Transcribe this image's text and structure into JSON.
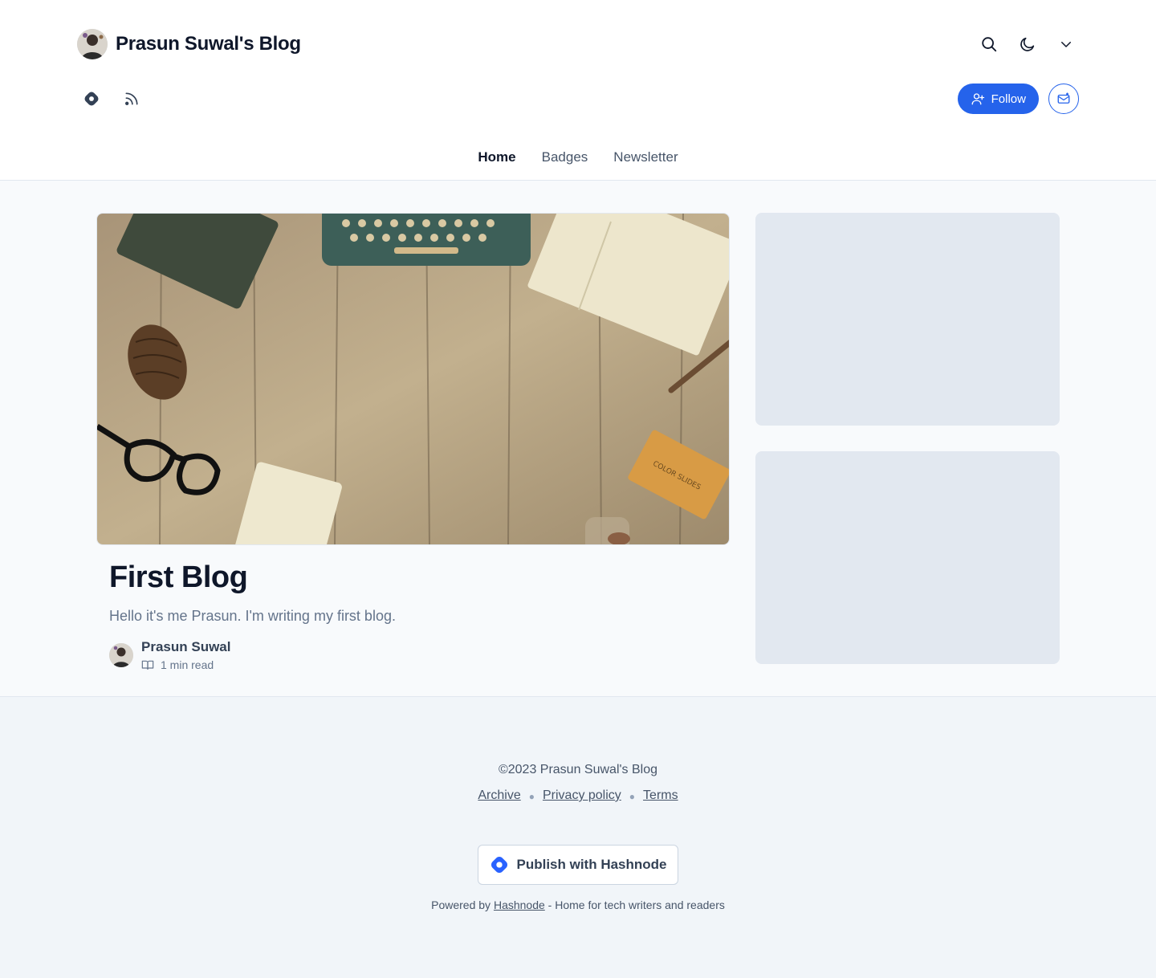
{
  "header": {
    "blog_title": "Prasun Suwal's Blog",
    "icons": [
      "search-icon",
      "moon-icon",
      "chevron-down-icon"
    ],
    "social_icons": [
      "hashnode-icon",
      "rss-icon"
    ],
    "follow_label": "Follow",
    "newsletter_icon": "mail-icon"
  },
  "nav": {
    "items": [
      {
        "label": "Home",
        "active": true
      },
      {
        "label": "Badges",
        "active": false
      },
      {
        "label": "Newsletter",
        "active": false
      }
    ]
  },
  "post": {
    "title": "First Blog",
    "brief": "Hello it's me Prasun. I'm writing my first blog.",
    "author": "Prasun Suwal",
    "read_time": "1 min read"
  },
  "footer": {
    "copyright": "©2023 Prasun Suwal's Blog",
    "links": [
      "Archive",
      "Privacy policy",
      "Terms"
    ],
    "publish_label": "Publish with Hashnode",
    "powered_prefix": "Powered by",
    "powered_link": "Hashnode",
    "powered_suffix": "- Home for tech writers and readers"
  },
  "colors": {
    "accent": "#2563eb",
    "page_bg": "#f8fafc",
    "footer_bg": "#f1f5f9",
    "placeholder": "#e2e8f0"
  }
}
